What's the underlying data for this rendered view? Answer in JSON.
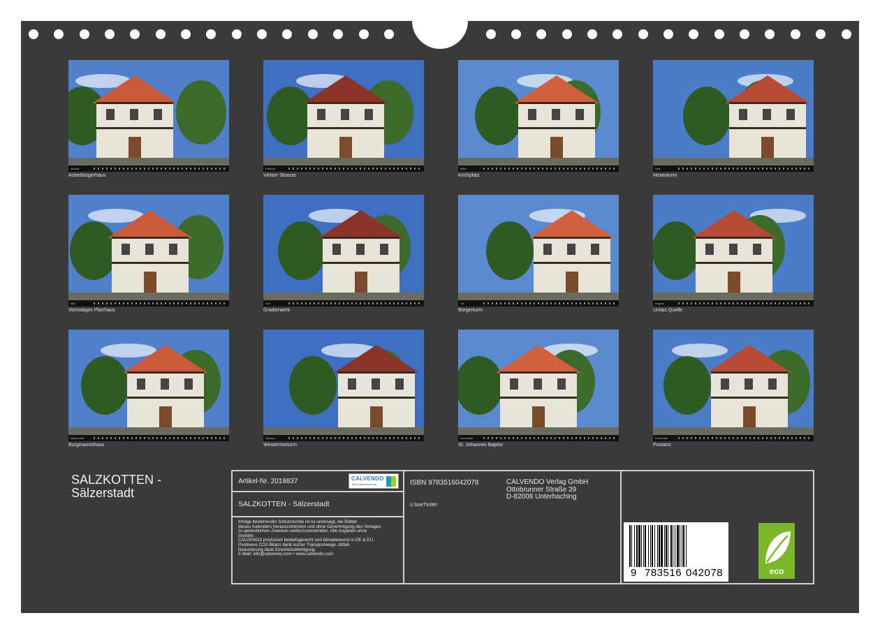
{
  "photos": [
    {
      "caption": "Ackerbürgerhaus",
      "month": "Januar"
    },
    {
      "caption": "Vielser Strasse",
      "month": "Februar"
    },
    {
      "caption": "Kirchplatz",
      "month": "März"
    },
    {
      "caption": "Hexenturm",
      "month": "April"
    },
    {
      "caption": "Vormaliges Pfarrhaus",
      "month": "Mai"
    },
    {
      "caption": "Gradierwerk",
      "month": "Juni"
    },
    {
      "caption": "Bürgerturm",
      "month": "Juli"
    },
    {
      "caption": "Unitas Quelle",
      "month": "August"
    },
    {
      "caption": "Burgmannshaus",
      "month": "September"
    },
    {
      "caption": "Westerntorturm",
      "month": "Oktober"
    },
    {
      "caption": "St. Johannes Baptist",
      "month": "November"
    },
    {
      "caption": "Postamt",
      "month": "Dezember"
    }
  ],
  "title": {
    "line1": "SALZKOTTEN -",
    "line2": "Sälzerstadt"
  },
  "info": {
    "artikel": "Artikel-Nr. 2018837",
    "logo_brand": "CALVENDO",
    "logo_tag": "Ihre Kalenderverlag",
    "subtitle": "SALZKOTTEN - Sälzerstadt",
    "fine_print": [
      "Infolge bestehender Schutzrechte ist es untersagt, die Blätter",
      "dieses Kalenders herauszutrennen und ohne Genehmigung des Verlages",
      "zu gewerblichen Zwecken weiterzuverwenden. Alle Angaben ohne",
      "Gewähr.",
      "CALVENDO produziert bedarfsgerecht und klimabewusst in DE & EU.",
      "Positivere CO2-Bilanz dank kurzer Transportwege. Abfall-",
      "Reduzierung dank Einzelstückfertigung.",
      "E-Mail: info@calvendo.com • www.calvendo.com"
    ],
    "isbn": "ISBN 9783516042078",
    "code": "U boeTtchEr",
    "publisher": [
      "CALVENDO Verlag GmbH",
      "Ottobrunner Straße 39",
      "D-82008 Unterhaching"
    ],
    "barcode_digits": [
      "9",
      "783516",
      "042078"
    ],
    "eco_label": "eco"
  },
  "colors": {
    "background": "#3a3a3a",
    "text": "#e6e6e6",
    "eco_green": "#7ab829",
    "calvendo_blue": "#2a7fb0"
  }
}
